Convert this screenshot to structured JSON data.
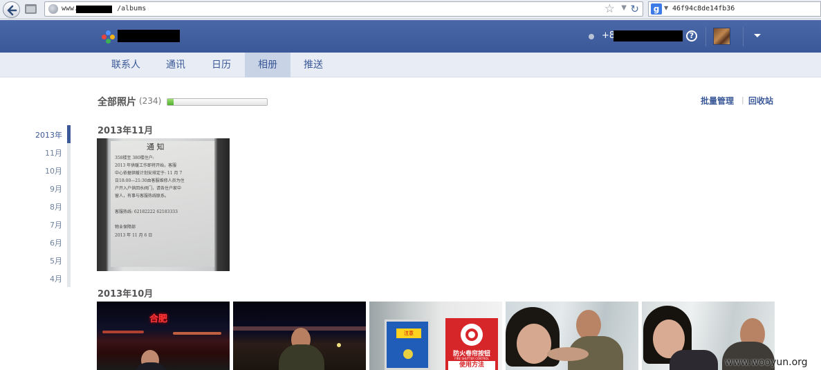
{
  "browser": {
    "url_prefix": "www.",
    "url_suffix": "/albums",
    "search_value": "46f94c8de14fb36"
  },
  "header": {
    "phone_prefix": "+8",
    "help_glyph": "?"
  },
  "tabs": [
    {
      "label": "联系人",
      "active": false
    },
    {
      "label": "通讯",
      "active": false
    },
    {
      "label": "日历",
      "active": false
    },
    {
      "label": "相册",
      "active": true
    },
    {
      "label": "推送",
      "active": false
    }
  ],
  "album": {
    "title": "全部照片",
    "count": "(234)",
    "storage_used_fraction": 0.06,
    "batch_manage": "批量管理",
    "separator": "|",
    "recycle_bin": "回收站"
  },
  "timeline": [
    {
      "label": "2013年",
      "active": true
    },
    {
      "label": "11月",
      "active": false
    },
    {
      "label": "10月",
      "active": false
    },
    {
      "label": "9月",
      "active": false
    },
    {
      "label": "8月",
      "active": false
    },
    {
      "label": "7月",
      "active": false
    },
    {
      "label": "6月",
      "active": false
    },
    {
      "label": "5月",
      "active": false
    },
    {
      "label": "4月",
      "active": false
    }
  ],
  "sections": {
    "nov": {
      "label": "2013年11月"
    },
    "oct": {
      "label": "2013年10月"
    }
  },
  "notice": {
    "title": "通 知",
    "lines": [
      "358楼至 380楼住户:",
      "  2013 年供暖工作即将开始，客服",
      "中心依据供暖计划安排定于: 11 月 7",
      "日18:00—21:30由客服维修人员为住",
      "户开入户供回水阀门，请各住户家中",
      "留人，有事与客服热线联系。",
      "",
      "客服热线: 62182222   62183333",
      "",
      "          物业保障部",
      "       2013 年 11 月 6 日"
    ]
  },
  "sign": {
    "warn": "注意",
    "fire": "防火卷帘按钮",
    "fire_en": "FIRE SHUTTER CONTROL",
    "usage": "使用方法",
    "hefei": "合肥"
  },
  "watermark": "www.wooyun.org",
  "colors": {
    "brand_blue": "#3b5998",
    "progress_green": "#4fae2d"
  }
}
